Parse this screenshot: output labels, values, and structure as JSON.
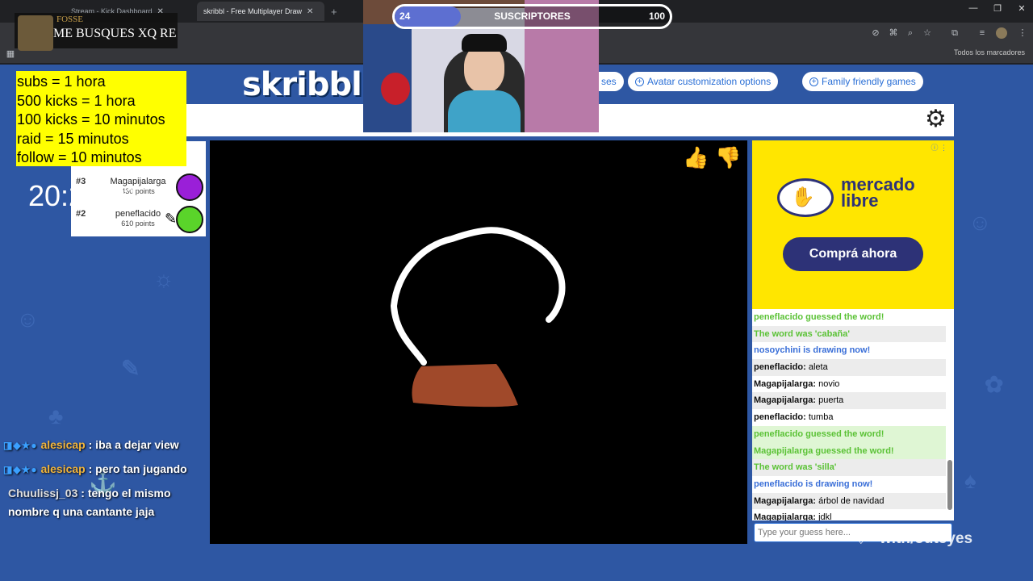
{
  "browser": {
    "tabs": [
      {
        "label": "FOSSE"
      },
      {
        "label": "Stream - Kick Dashboard"
      },
      {
        "label": "skribbl - Free Multiplayer Draw"
      }
    ],
    "new_tab": "+",
    "bookmarks_label": "Todos los marcadores"
  },
  "skribbl": {
    "logo": "skribbl.io",
    "pills": [
      "ses",
      "Avatar customization options",
      "Family friendly games"
    ],
    "players": [
      {
        "rank": "#3",
        "name": "Magapijalarga",
        "points": "430 points",
        "color": "#9a1fd8"
      },
      {
        "rank": "#2",
        "name": "peneflacido",
        "points": "610 points",
        "color": "#5ad42a"
      }
    ],
    "chat": [
      {
        "type": "green",
        "text": "peneflacido guessed the word!"
      },
      {
        "type": "green",
        "text": "The word was 'cabaña'"
      },
      {
        "type": "blue",
        "text": "nosoychini is drawing now!"
      },
      {
        "type": "msg",
        "user": "peneflacido:",
        "text": "aleta"
      },
      {
        "type": "msg",
        "user": "Magapijalarga:",
        "text": "novio"
      },
      {
        "type": "msg",
        "user": "Magapijalarga:",
        "text": "puerta"
      },
      {
        "type": "msg",
        "user": "peneflacido:",
        "text": "tumba"
      },
      {
        "type": "greenbg",
        "text": "peneflacido guessed the word!"
      },
      {
        "type": "greenbg",
        "text": "Magapijalarga guessed the word!"
      },
      {
        "type": "green",
        "text": "The word was 'silla'"
      },
      {
        "type": "blue",
        "text": "peneflacido is drawing now!"
      },
      {
        "type": "msg",
        "user": "Magapijalarga:",
        "text": "árbol de navidad"
      },
      {
        "type": "msg",
        "user": "Magapijalarga:",
        "text": "jdkl"
      }
    ],
    "guess_placeholder": "Type your guess here..."
  },
  "ad": {
    "brand_line1": "mercado",
    "brand_line2": "libre",
    "cta": "Comprá ahora"
  },
  "overlay": {
    "rules": [
      "subs = 1 hora",
      "500 kicks = 1 hora",
      "100 kicks = 10 minutos",
      "raid = 15 minutos",
      "follow = 10 minutos"
    ],
    "clock": "20:23:01",
    "notification": {
      "name": "FOSSE",
      "text": "ME BUSQUES XQ RE"
    },
    "sub_goal": {
      "current": "24",
      "title": "SUSCRIPTORES",
      "goal": "100",
      "progress": 0.24
    },
    "stream_chat": [
      {
        "user": "alesicap",
        "text": ": iba a dejar view",
        "badges": true
      },
      {
        "user": "alesicap",
        "text": ": pero tan jugando",
        "badges": true
      },
      {
        "user": "Chuulissj_03",
        "text": ": tengo el mismo nombre q una cantante jaja",
        "badges": false
      }
    ],
    "brand": "with/outeyes"
  },
  "colors": {
    "page_bg": "#2e57a3",
    "ad_yellow": "#ffe600",
    "rules_yellow": "#ffff00"
  }
}
